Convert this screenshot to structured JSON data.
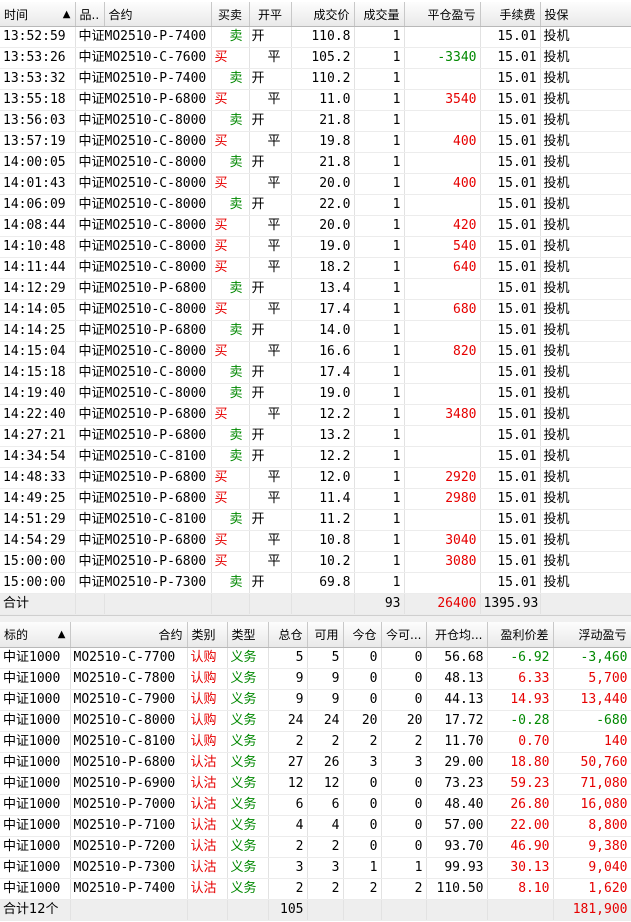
{
  "colors": {
    "buy": "#e60000",
    "sell": "#008800",
    "header_bg": "#e9e9e9"
  },
  "trades": {
    "headers": {
      "time": "时间",
      "sort_icon": "▲",
      "product": "品..",
      "contract": "合约",
      "side": "买卖",
      "openclose": "开平",
      "price": "成交价",
      "qty": "成交量",
      "pnl": "平仓盈亏",
      "fee": "手续费",
      "hedge": "投保"
    },
    "rows": [
      {
        "time": "13:52:59",
        "contract": "中证MO2510-P-7400",
        "side": "卖",
        "oc": "开",
        "price": "110.8",
        "qty": "1",
        "pnl": "",
        "fee": "15.01",
        "hedge": "投机"
      },
      {
        "time": "13:53:26",
        "contract": "中证MO2510-C-7600",
        "side": "买",
        "oc": "平",
        "price": "105.2",
        "qty": "1",
        "pnl": "-3340",
        "fee": "15.01",
        "hedge": "投机"
      },
      {
        "time": "13:53:32",
        "contract": "中证MO2510-P-7400",
        "side": "卖",
        "oc": "开",
        "price": "110.2",
        "qty": "1",
        "pnl": "",
        "fee": "15.01",
        "hedge": "投机"
      },
      {
        "time": "13:55:18",
        "contract": "中证MO2510-P-6800",
        "side": "买",
        "oc": "平",
        "price": "11.0",
        "qty": "1",
        "pnl": "3540",
        "fee": "15.01",
        "hedge": "投机"
      },
      {
        "time": "13:56:03",
        "contract": "中证MO2510-C-8000",
        "side": "卖",
        "oc": "开",
        "price": "21.8",
        "qty": "1",
        "pnl": "",
        "fee": "15.01",
        "hedge": "投机"
      },
      {
        "time": "13:57:19",
        "contract": "中证MO2510-C-8000",
        "side": "买",
        "oc": "平",
        "price": "19.8",
        "qty": "1",
        "pnl": "400",
        "fee": "15.01",
        "hedge": "投机"
      },
      {
        "time": "14:00:05",
        "contract": "中证MO2510-C-8000",
        "side": "卖",
        "oc": "开",
        "price": "21.8",
        "qty": "1",
        "pnl": "",
        "fee": "15.01",
        "hedge": "投机"
      },
      {
        "time": "14:01:43",
        "contract": "中证MO2510-C-8000",
        "side": "买",
        "oc": "平",
        "price": "20.0",
        "qty": "1",
        "pnl": "400",
        "fee": "15.01",
        "hedge": "投机"
      },
      {
        "time": "14:06:09",
        "contract": "中证MO2510-C-8000",
        "side": "卖",
        "oc": "开",
        "price": "22.0",
        "qty": "1",
        "pnl": "",
        "fee": "15.01",
        "hedge": "投机"
      },
      {
        "time": "14:08:44",
        "contract": "中证MO2510-C-8000",
        "side": "买",
        "oc": "平",
        "price": "20.0",
        "qty": "1",
        "pnl": "420",
        "fee": "15.01",
        "hedge": "投机"
      },
      {
        "time": "14:10:48",
        "contract": "中证MO2510-C-8000",
        "side": "买",
        "oc": "平",
        "price": "19.0",
        "qty": "1",
        "pnl": "540",
        "fee": "15.01",
        "hedge": "投机"
      },
      {
        "time": "14:11:44",
        "contract": "中证MO2510-C-8000",
        "side": "买",
        "oc": "平",
        "price": "18.2",
        "qty": "1",
        "pnl": "640",
        "fee": "15.01",
        "hedge": "投机"
      },
      {
        "time": "14:12:29",
        "contract": "中证MO2510-P-6800",
        "side": "卖",
        "oc": "开",
        "price": "13.4",
        "qty": "1",
        "pnl": "",
        "fee": "15.01",
        "hedge": "投机"
      },
      {
        "time": "14:14:05",
        "contract": "中证MO2510-C-8000",
        "side": "买",
        "oc": "平",
        "price": "17.4",
        "qty": "1",
        "pnl": "680",
        "fee": "15.01",
        "hedge": "投机"
      },
      {
        "time": "14:14:25",
        "contract": "中证MO2510-P-6800",
        "side": "卖",
        "oc": "开",
        "price": "14.0",
        "qty": "1",
        "pnl": "",
        "fee": "15.01",
        "hedge": "投机"
      },
      {
        "time": "14:15:04",
        "contract": "中证MO2510-C-8000",
        "side": "买",
        "oc": "平",
        "price": "16.6",
        "qty": "1",
        "pnl": "820",
        "fee": "15.01",
        "hedge": "投机"
      },
      {
        "time": "14:15:18",
        "contract": "中证MO2510-C-8000",
        "side": "卖",
        "oc": "开",
        "price": "17.4",
        "qty": "1",
        "pnl": "",
        "fee": "15.01",
        "hedge": "投机"
      },
      {
        "time": "14:19:40",
        "contract": "中证MO2510-C-8000",
        "side": "卖",
        "oc": "开",
        "price": "19.0",
        "qty": "1",
        "pnl": "",
        "fee": "15.01",
        "hedge": "投机"
      },
      {
        "time": "14:22:40",
        "contract": "中证MO2510-P-6800",
        "side": "买",
        "oc": "平",
        "price": "12.2",
        "qty": "1",
        "pnl": "3480",
        "fee": "15.01",
        "hedge": "投机"
      },
      {
        "time": "14:27:21",
        "contract": "中证MO2510-P-6800",
        "side": "卖",
        "oc": "开",
        "price": "13.2",
        "qty": "1",
        "pnl": "",
        "fee": "15.01",
        "hedge": "投机"
      },
      {
        "time": "14:34:54",
        "contract": "中证MO2510-C-8100",
        "side": "卖",
        "oc": "开",
        "price": "12.2",
        "qty": "1",
        "pnl": "",
        "fee": "15.01",
        "hedge": "投机"
      },
      {
        "time": "14:48:33",
        "contract": "中证MO2510-P-6800",
        "side": "买",
        "oc": "平",
        "price": "12.0",
        "qty": "1",
        "pnl": "2920",
        "fee": "15.01",
        "hedge": "投机"
      },
      {
        "time": "14:49:25",
        "contract": "中证MO2510-P-6800",
        "side": "买",
        "oc": "平",
        "price": "11.4",
        "qty": "1",
        "pnl": "2980",
        "fee": "15.01",
        "hedge": "投机"
      },
      {
        "time": "14:51:29",
        "contract": "中证MO2510-C-8100",
        "side": "卖",
        "oc": "开",
        "price": "11.2",
        "qty": "1",
        "pnl": "",
        "fee": "15.01",
        "hedge": "投机"
      },
      {
        "time": "14:54:29",
        "contract": "中证MO2510-P-6800",
        "side": "买",
        "oc": "平",
        "price": "10.8",
        "qty": "1",
        "pnl": "3040",
        "fee": "15.01",
        "hedge": "投机"
      },
      {
        "time": "15:00:00",
        "contract": "中证MO2510-P-6800",
        "side": "买",
        "oc": "平",
        "price": "10.2",
        "qty": "1",
        "pnl": "3080",
        "fee": "15.01",
        "hedge": "投机"
      },
      {
        "time": "15:00:00",
        "contract": "中证MO2510-P-7300",
        "side": "卖",
        "oc": "开",
        "price": "69.8",
        "qty": "1",
        "pnl": "",
        "fee": "15.01",
        "hedge": "投机"
      }
    ],
    "total": {
      "label": "合计",
      "qty": "93",
      "pnl": "26400",
      "fee": "1395.93"
    }
  },
  "positions": {
    "headers": {
      "underlying": "标的",
      "sort_icon": "▲",
      "contract": "合约",
      "category": "类别",
      "type": "类型",
      "total": "总仓",
      "avail": "可用",
      "today": "今仓",
      "today_avail": "今可...",
      "avg": "开仓均...",
      "spread": "盈利价差",
      "float_pnl": "浮动盈亏"
    },
    "rows": [
      {
        "underlying": "中证1000",
        "contract": "MO2510-C-7700",
        "category": "认购",
        "type": "义务",
        "total": "5",
        "avail": "5",
        "today": "0",
        "today_avail": "0",
        "avg": "56.68",
        "spread": "-6.92",
        "float_pnl": "-3,460"
      },
      {
        "underlying": "中证1000",
        "contract": "MO2510-C-7800",
        "category": "认购",
        "type": "义务",
        "total": "9",
        "avail": "9",
        "today": "0",
        "today_avail": "0",
        "avg": "48.13",
        "spread": "6.33",
        "float_pnl": "5,700"
      },
      {
        "underlying": "中证1000",
        "contract": "MO2510-C-7900",
        "category": "认购",
        "type": "义务",
        "total": "9",
        "avail": "9",
        "today": "0",
        "today_avail": "0",
        "avg": "44.13",
        "spread": "14.93",
        "float_pnl": "13,440"
      },
      {
        "underlying": "中证1000",
        "contract": "MO2510-C-8000",
        "category": "认购",
        "type": "义务",
        "total": "24",
        "avail": "24",
        "today": "20",
        "today_avail": "20",
        "avg": "17.72",
        "spread": "-0.28",
        "float_pnl": "-680"
      },
      {
        "underlying": "中证1000",
        "contract": "MO2510-C-8100",
        "category": "认购",
        "type": "义务",
        "total": "2",
        "avail": "2",
        "today": "2",
        "today_avail": "2",
        "avg": "11.70",
        "spread": "0.70",
        "float_pnl": "140"
      },
      {
        "underlying": "中证1000",
        "contract": "MO2510-P-6800",
        "category": "认沽",
        "type": "义务",
        "total": "27",
        "avail": "26",
        "today": "3",
        "today_avail": "3",
        "avg": "29.00",
        "spread": "18.80",
        "float_pnl": "50,760"
      },
      {
        "underlying": "中证1000",
        "contract": "MO2510-P-6900",
        "category": "认沽",
        "type": "义务",
        "total": "12",
        "avail": "12",
        "today": "0",
        "today_avail": "0",
        "avg": "73.23",
        "spread": "59.23",
        "float_pnl": "71,080"
      },
      {
        "underlying": "中证1000",
        "contract": "MO2510-P-7000",
        "category": "认沽",
        "type": "义务",
        "total": "6",
        "avail": "6",
        "today": "0",
        "today_avail": "0",
        "avg": "48.40",
        "spread": "26.80",
        "float_pnl": "16,080"
      },
      {
        "underlying": "中证1000",
        "contract": "MO2510-P-7100",
        "category": "认沽",
        "type": "义务",
        "total": "4",
        "avail": "4",
        "today": "0",
        "today_avail": "0",
        "avg": "57.00",
        "spread": "22.00",
        "float_pnl": "8,800"
      },
      {
        "underlying": "中证1000",
        "contract": "MO2510-P-7200",
        "category": "认沽",
        "type": "义务",
        "total": "2",
        "avail": "2",
        "today": "0",
        "today_avail": "0",
        "avg": "93.70",
        "spread": "46.90",
        "float_pnl": "9,380"
      },
      {
        "underlying": "中证1000",
        "contract": "MO2510-P-7300",
        "category": "认沽",
        "type": "义务",
        "total": "3",
        "avail": "3",
        "today": "1",
        "today_avail": "1",
        "avg": "99.93",
        "spread": "30.13",
        "float_pnl": "9,040"
      },
      {
        "underlying": "中证1000",
        "contract": "MO2510-P-7400",
        "category": "认沽",
        "type": "义务",
        "total": "2",
        "avail": "2",
        "today": "2",
        "today_avail": "2",
        "avg": "110.50",
        "spread": "8.10",
        "float_pnl": "1,620"
      }
    ],
    "total": {
      "label": "合计12个",
      "total": "105",
      "float_pnl": "181,900"
    }
  }
}
